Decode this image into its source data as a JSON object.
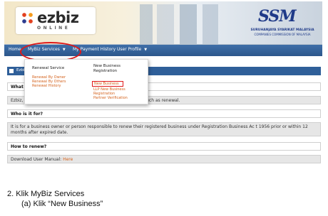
{
  "header": {
    "logo_text": "ezbiz",
    "logo_sub": "ONLINE",
    "agency_logo": "SSM",
    "agency_name": "SURUHANJAYA SYARIKAT MALAYSIA",
    "agency_name_en": "COMPANIES COMMISSION OF MALAYSIA"
  },
  "nav": {
    "items": [
      {
        "label": "Home"
      },
      {
        "label": "MyBiz Services",
        "arrow": "▼"
      },
      {
        "label": "My Payment History"
      },
      {
        "label": "User Profile",
        "arrow": "▼"
      }
    ]
  },
  "dropdown": {
    "renewal_heading": "Renewal Service",
    "renewal_links": [
      "Renewal By Owner",
      "Renewal By Others",
      "Renewal History"
    ],
    "newbiz_heading_1": "New Business",
    "newbiz_heading_2": "Registration",
    "newbiz_links": [
      "New Business",
      "LLP New Business",
      "Registration",
      "Partner Verification"
    ]
  },
  "panel": {
    "title": "Ezbiz"
  },
  "content": {
    "q1": "What is",
    "a1_left": "Ezbiz, is",
    "a1_right": "s such as renewal.",
    "q2": "Who is it for?",
    "a2": "It is for a business owner or person responsible to renew their registered business under Registration Business Ac t 1956 prior or within 12 months after expired date.",
    "q3": "How to renew?",
    "a3_prefix": "Download User Manual:",
    "a3_link": "Here"
  },
  "caption": {
    "step": "2.  Klik MyBiz Services",
    "substep": "(a)  Klik “New Business”"
  },
  "colors": {
    "navbar": "#2c578c",
    "link": "#d4621c",
    "highlight": "#e01818"
  }
}
